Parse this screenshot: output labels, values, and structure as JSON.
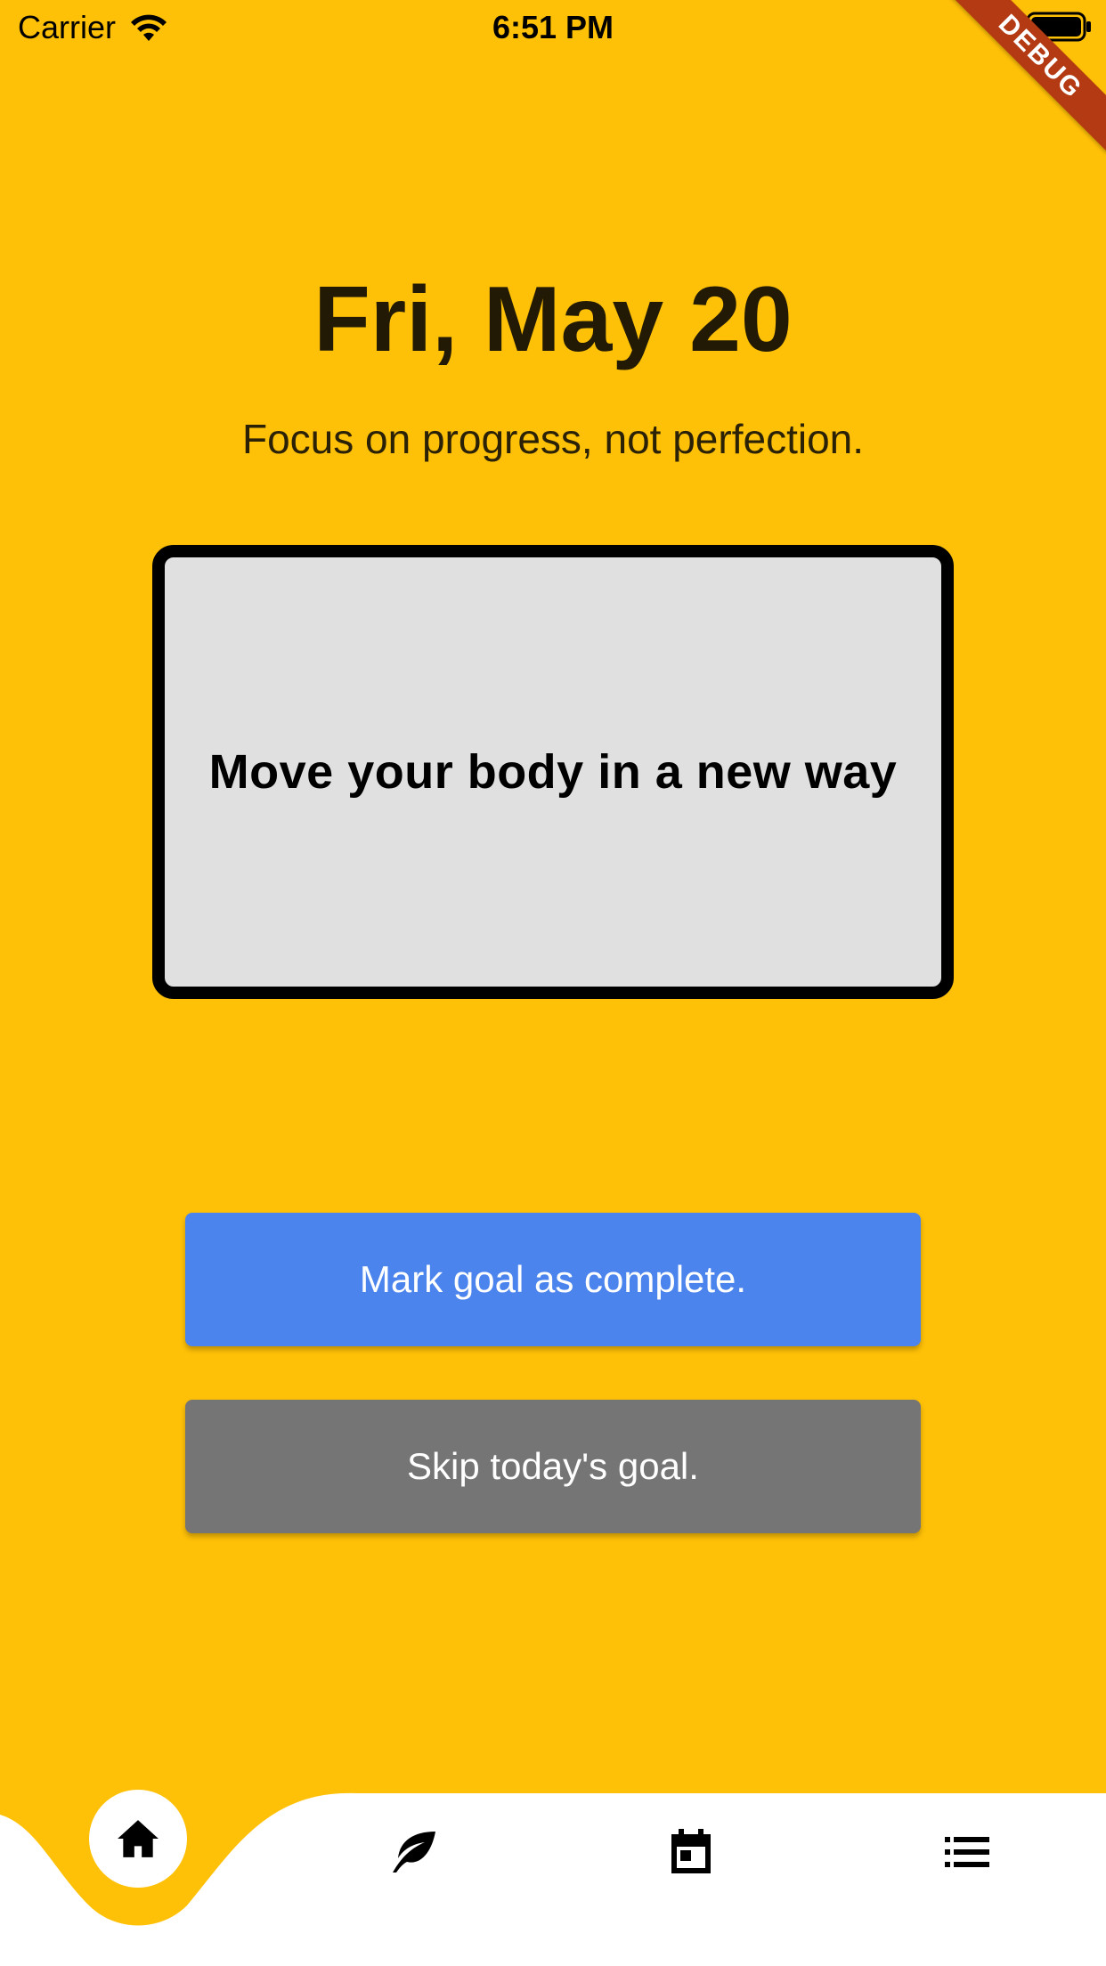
{
  "status_bar": {
    "carrier": "Carrier",
    "time": "6:51 PM"
  },
  "debug_banner": {
    "label": "DEBUG"
  },
  "header": {
    "date": "Fri, May 20",
    "subtitle": "Focus on progress, not perfection."
  },
  "goal_card": {
    "text": "Move your body in a new way"
  },
  "actions": {
    "complete_label": "Mark goal as complete.",
    "skip_label": "Skip today's goal."
  },
  "bottom_nav": {
    "items": [
      {
        "icon": "home-icon",
        "selected": true
      },
      {
        "icon": "leaf-icon",
        "selected": false
      },
      {
        "icon": "calendar-icon",
        "selected": false
      },
      {
        "icon": "list-icon",
        "selected": false
      }
    ]
  },
  "colors": {
    "background": "#FFC107",
    "card": "#E0E0E0",
    "complete_button": "#4C84EE",
    "skip_button": "#757575",
    "debug_ribbon": "#B33A12",
    "nav_bar": "#FFFFFF"
  }
}
